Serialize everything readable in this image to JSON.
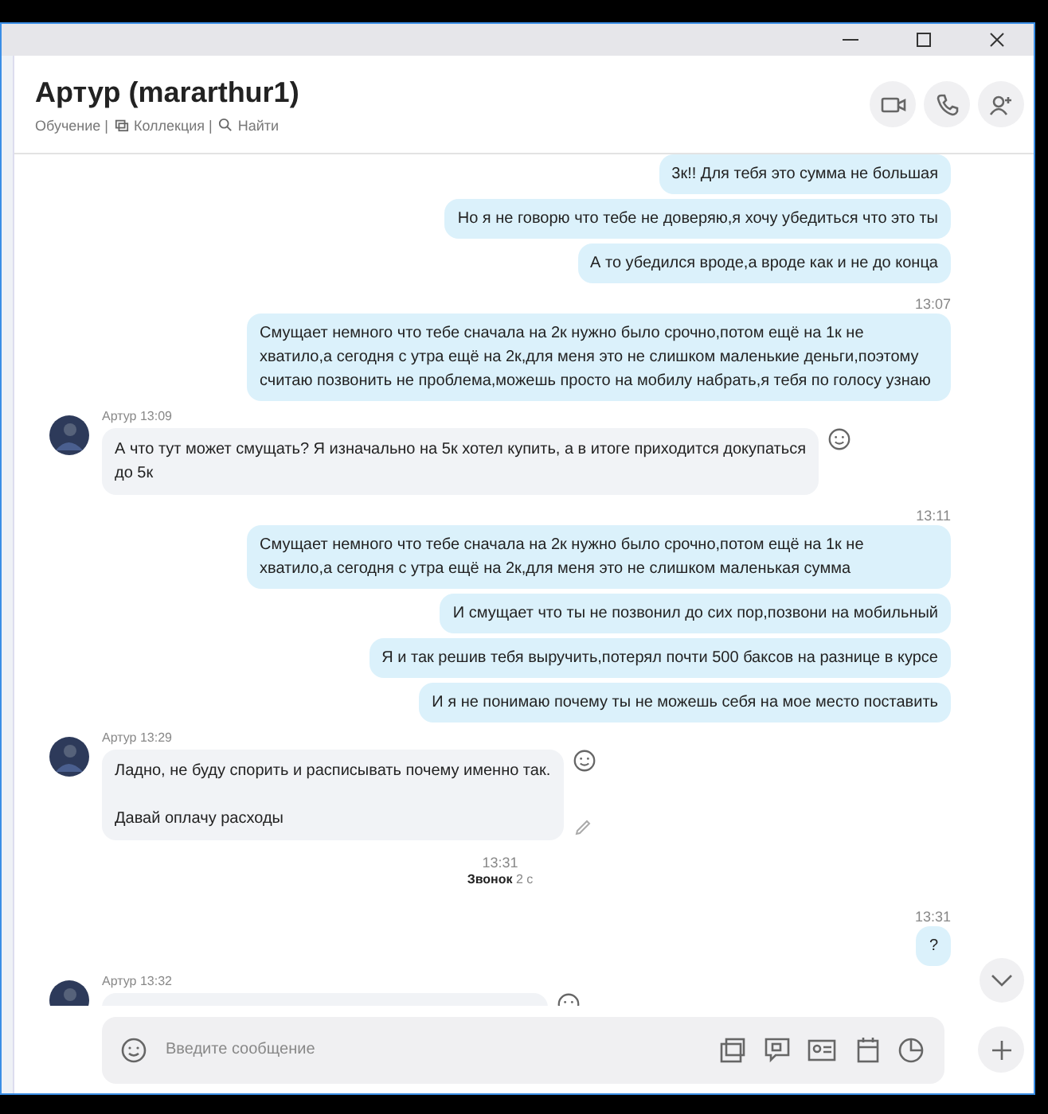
{
  "header": {
    "title": "Артур (mararthur1)",
    "links": [
      {
        "kind": "plain",
        "label": "Обучение |"
      },
      {
        "kind": "gallery",
        "label": "Коллекция |"
      },
      {
        "kind": "search",
        "label": "Найти"
      }
    ]
  },
  "messages": [
    {
      "kind": "out",
      "text": "3к!! Для тебя это сумма не большая"
    },
    {
      "kind": "out",
      "text": "Но я не говорю что тебе не доверяю,я хочу убедиться что это ты"
    },
    {
      "kind": "out",
      "text": "А то убедился вроде,а вроде как и не до конца"
    },
    {
      "kind": "out",
      "time": "13:07",
      "text": "Смущает немного что тебе сначала на 2к нужно было срочно,потом ещё на 1к не хватило,а сегодня с утра ещё на 2к,для меня это не слишком маленькие деньги,поэтому считаю позвонить не проблема,можешь просто на мобилу набрать,я тебя по голосу узнаю"
    },
    {
      "kind": "in",
      "author": "Артур",
      "time": "13:09",
      "text": "А что тут может смущать? Я изначально на 5к хотел купить, а в итоге приходится докупаться до 5к",
      "edited": false
    },
    {
      "kind": "out",
      "time": "13:11",
      "text": "Смущает немного что тебе сначала на 2к нужно было срочно,потом ещё на 1к не хватило,а сегодня с утра ещё на 2к,для меня это не слишком маленькая сумма"
    },
    {
      "kind": "out",
      "text": "И смущает что ты не позвонил до сих пор,позвони на мобильный"
    },
    {
      "kind": "out",
      "text": "Я и так решив тебя выручить,потерял почти 500 баксов на разнице в курсе"
    },
    {
      "kind": "out",
      "text": "И я не понимаю почему ты не можешь себя на мое место поставить"
    },
    {
      "kind": "in",
      "author": "Артур",
      "time": "13:29",
      "text": "Ладно, не буду спорить и расписывать почему именно так.\n\nДавай оплачу расходы",
      "edited": true
    },
    {
      "kind": "call",
      "time": "13:31",
      "label": "Звонок",
      "duration": "2 с"
    },
    {
      "kind": "out",
      "time": "13:31",
      "text": "?"
    },
    {
      "kind": "in",
      "author": "Артур",
      "time": "13:32",
      "edited": false
    }
  ],
  "composer": {
    "placeholder": "Введите сообщение"
  }
}
